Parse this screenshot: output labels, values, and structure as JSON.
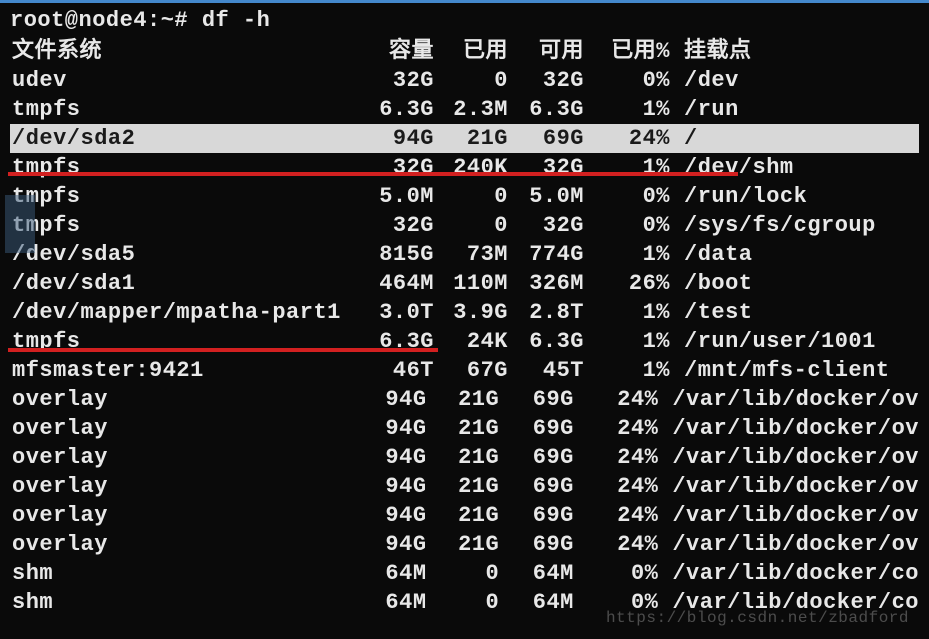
{
  "prompt": "root@node4:~# df -h",
  "headers": {
    "filesystem": "文件系统",
    "size": "容量",
    "used": "已用",
    "avail": "可用",
    "use_pct": "已用%",
    "mounted": "挂载点"
  },
  "rows": [
    {
      "fs": "udev",
      "size": "32G",
      "used": "0",
      "avail": "32G",
      "pct": "0%",
      "mount": "/dev",
      "hl": false
    },
    {
      "fs": "tmpfs",
      "size": "6.3G",
      "used": "2.3M",
      "avail": "6.3G",
      "pct": "1%",
      "mount": "/run",
      "hl": false
    },
    {
      "fs": "/dev/sda2",
      "size": "94G",
      "used": "21G",
      "avail": "69G",
      "pct": "24%",
      "mount": "/",
      "hl": true
    },
    {
      "fs": "tmpfs",
      "size": "32G",
      "used": "240K",
      "avail": "32G",
      "pct": "1%",
      "mount": "/dev/shm",
      "hl": false
    },
    {
      "fs": "tmpfs",
      "size": "5.0M",
      "used": "0",
      "avail": "5.0M",
      "pct": "0%",
      "mount": "/run/lock",
      "hl": false,
      "leftcover": true
    },
    {
      "fs": "tmpfs",
      "size": "32G",
      "used": "0",
      "avail": "32G",
      "pct": "0%",
      "mount": "/sys/fs/cgroup",
      "hl": false
    },
    {
      "fs": "/dev/sda5",
      "size": "815G",
      "used": "73M",
      "avail": "774G",
      "pct": "1%",
      "mount": "/data",
      "hl": false
    },
    {
      "fs": "/dev/sda1",
      "size": "464M",
      "used": "110M",
      "avail": "326M",
      "pct": "26%",
      "mount": "/boot",
      "hl": false
    },
    {
      "fs": "/dev/mapper/mpatha-part1",
      "size": "3.0T",
      "used": "3.9G",
      "avail": "2.8T",
      "pct": "1%",
      "mount": "/test",
      "hl": false
    },
    {
      "fs": "tmpfs",
      "size": "6.3G",
      "used": "24K",
      "avail": "6.3G",
      "pct": "1%",
      "mount": "/run/user/1001",
      "hl": false
    },
    {
      "fs": "mfsmaster:9421",
      "size": "46T",
      "used": "67G",
      "avail": "45T",
      "pct": "1%",
      "mount": "/mnt/mfs-client",
      "hl": false
    },
    {
      "fs": "overlay",
      "size": "94G",
      "used": "21G",
      "avail": "69G",
      "pct": "24%",
      "mount": "/var/lib/docker/ov",
      "hl": false
    },
    {
      "fs": "overlay",
      "size": "94G",
      "used": "21G",
      "avail": "69G",
      "pct": "24%",
      "mount": "/var/lib/docker/ov",
      "hl": false
    },
    {
      "fs": "overlay",
      "size": "94G",
      "used": "21G",
      "avail": "69G",
      "pct": "24%",
      "mount": "/var/lib/docker/ov",
      "hl": false
    },
    {
      "fs": "overlay",
      "size": "94G",
      "used": "21G",
      "avail": "69G",
      "pct": "24%",
      "mount": "/var/lib/docker/ov",
      "hl": false
    },
    {
      "fs": "overlay",
      "size": "94G",
      "used": "21G",
      "avail": "69G",
      "pct": "24%",
      "mount": "/var/lib/docker/ov",
      "hl": false
    },
    {
      "fs": "overlay",
      "size": "94G",
      "used": "21G",
      "avail": "69G",
      "pct": "24%",
      "mount": "/var/lib/docker/ov",
      "hl": false
    },
    {
      "fs": "shm",
      "size": "64M",
      "used": "0",
      "avail": "64M",
      "pct": "0%",
      "mount": "/var/lib/docker/co",
      "hl": false
    },
    {
      "fs": "shm",
      "size": "64M",
      "used": "0",
      "avail": "64M",
      "pct": "0%",
      "mount": "/var/lib/docker/co",
      "hl": false
    }
  ],
  "watermark": "https://blog.csdn.net/zbadford",
  "annotation_colors": {
    "highlight_bg": "#d8d8d8",
    "highlight_fg": "#1a1a1a",
    "underline": "#d22020"
  }
}
